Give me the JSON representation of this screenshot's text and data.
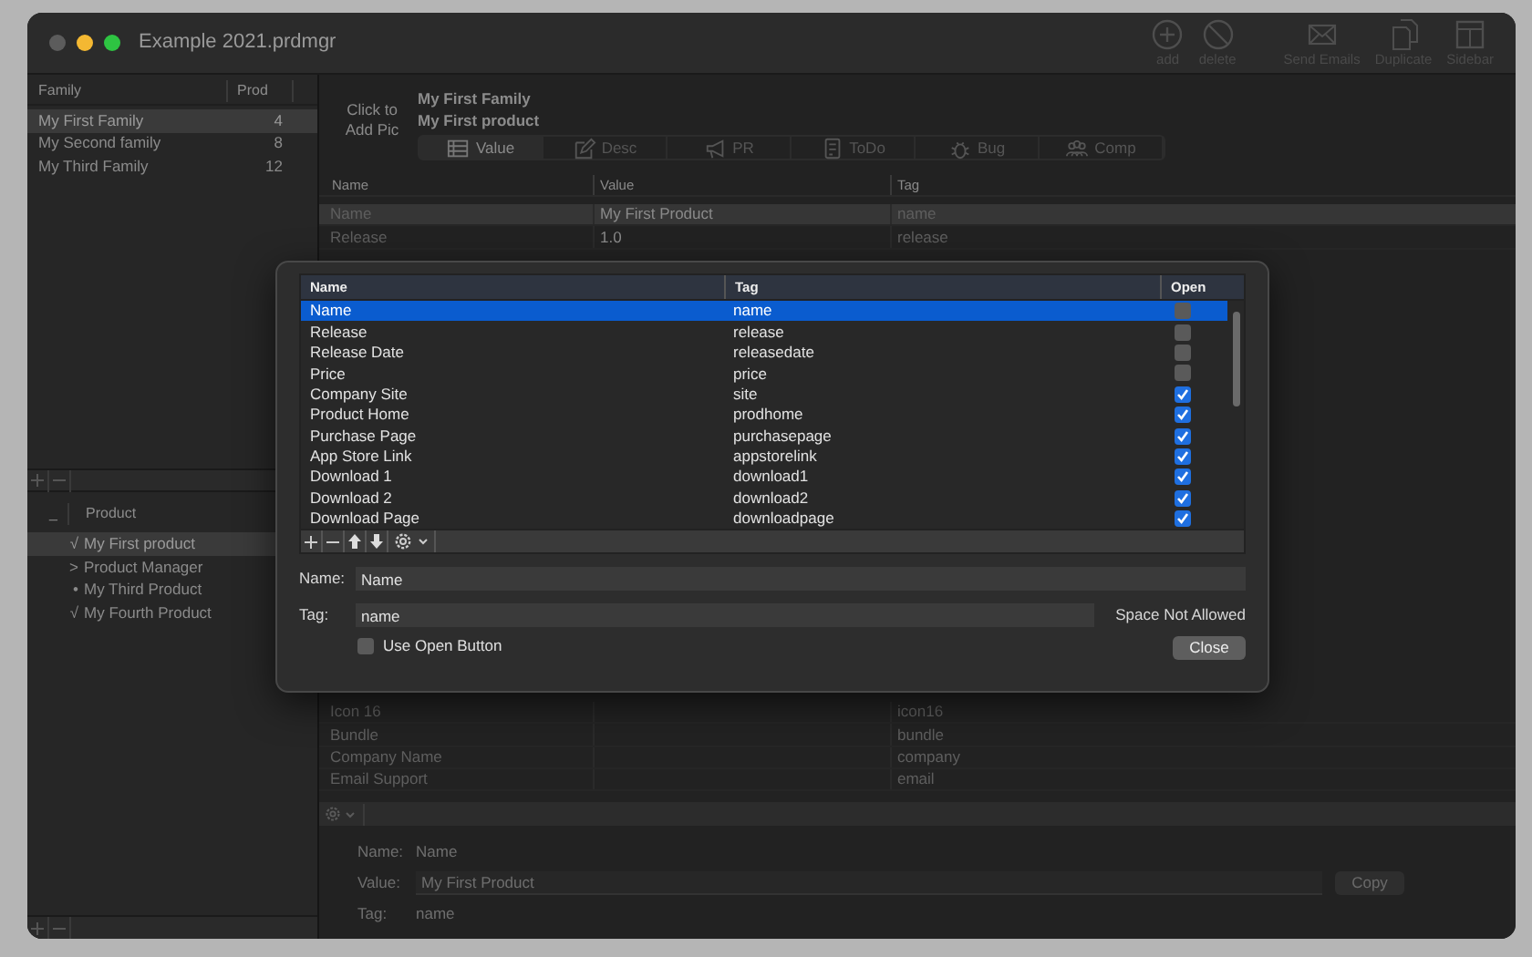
{
  "window": {
    "title": "Example 2021.prdmgr"
  },
  "toolbar": [
    {
      "kind": "add",
      "label": "add"
    },
    {
      "kind": "delete",
      "label": "delete"
    },
    {
      "kind": "mail",
      "label": "Send Emails"
    },
    {
      "kind": "duplicate",
      "label": "Duplicate"
    },
    {
      "kind": "sidebar",
      "label": "Sidebar"
    }
  ],
  "families": {
    "columns": [
      "Family",
      "Prod"
    ],
    "rows": [
      {
        "name": "My First Family",
        "count": "4",
        "selected": true
      },
      {
        "name": "My Second family",
        "count": "8",
        "selected": false
      },
      {
        "name": "My Third Family",
        "count": "12",
        "selected": false
      }
    ]
  },
  "products": {
    "columns": [
      "_",
      "Product"
    ],
    "rows": [
      {
        "marker": "√",
        "name": "My First product",
        "selected": true
      },
      {
        "marker": ">",
        "name": "Product Manager",
        "selected": false
      },
      {
        "marker": "•",
        "name": "My Third Product",
        "selected": false
      },
      {
        "marker": "√",
        "name": "My Fourth Product",
        "selected": false
      }
    ]
  },
  "product_header": {
    "picture_hint": "Click to Add Pic",
    "family": "My First Family",
    "product": "My First product"
  },
  "tabs": [
    {
      "kind": "list",
      "label": "Value",
      "selected": true
    },
    {
      "kind": "pencil",
      "label": "Desc",
      "selected": false
    },
    {
      "kind": "megaphone",
      "label": "PR",
      "selected": false
    },
    {
      "kind": "todo",
      "label": "ToDo",
      "selected": false
    },
    {
      "kind": "bug",
      "label": "Bug",
      "selected": false
    },
    {
      "kind": "people",
      "label": "Comp",
      "selected": false
    }
  ],
  "fields_table": {
    "columns": [
      "Name",
      "Value",
      "Tag"
    ],
    "rows_above": [
      {
        "name": "Name",
        "value": "My First Product",
        "tag": "name",
        "selected": true
      },
      {
        "name": "Release",
        "value": "1.0",
        "tag": "release",
        "selected": false
      }
    ],
    "rows_below": [
      {
        "name": "Icon 16",
        "tag": "icon16",
        "selected": false
      },
      {
        "name": "Bundle",
        "tag": "bundle",
        "selected": false
      },
      {
        "name": "Company Name",
        "tag": "company",
        "selected": false
      },
      {
        "name": "Email Support",
        "tag": "email",
        "selected": false
      }
    ]
  },
  "detail": {
    "name_label": "Name:",
    "name": "Name",
    "value_label": "Value:",
    "value": "My First Product",
    "copy_button": "Copy",
    "tag_label": "Tag:",
    "tag": "name"
  },
  "sheet": {
    "columns": [
      "Name",
      "Tag",
      "Open"
    ],
    "rows": [
      {
        "name": "Name",
        "tag": "name",
        "open": false,
        "selected": true
      },
      {
        "name": "Release",
        "tag": "release",
        "open": false,
        "selected": false
      },
      {
        "name": "Release Date",
        "tag": "releasedate",
        "open": false,
        "selected": false
      },
      {
        "name": "Price",
        "tag": "price",
        "open": false,
        "selected": false
      },
      {
        "name": "Company Site",
        "tag": "site",
        "open": true,
        "selected": false
      },
      {
        "name": "Product Home",
        "tag": "prodhome",
        "open": true,
        "selected": false
      },
      {
        "name": "Purchase Page",
        "tag": "purchasepage",
        "open": true,
        "selected": false
      },
      {
        "name": "App Store Link",
        "tag": "appstorelink",
        "open": true,
        "selected": false
      },
      {
        "name": "Download 1",
        "tag": "download1",
        "open": true,
        "selected": false
      },
      {
        "name": "Download 2",
        "tag": "download2",
        "open": true,
        "selected": false
      },
      {
        "name": "Download Page",
        "tag": "downloadpage",
        "open": true,
        "selected": false
      }
    ],
    "name_label": "Name:",
    "name_value": "Name",
    "tag_label": "Tag:",
    "tag_value": "name",
    "tag_hint": "Space Not Allowed",
    "use_open_button": {
      "label": "Use Open Button",
      "checked": false
    },
    "close_button": "Close"
  }
}
